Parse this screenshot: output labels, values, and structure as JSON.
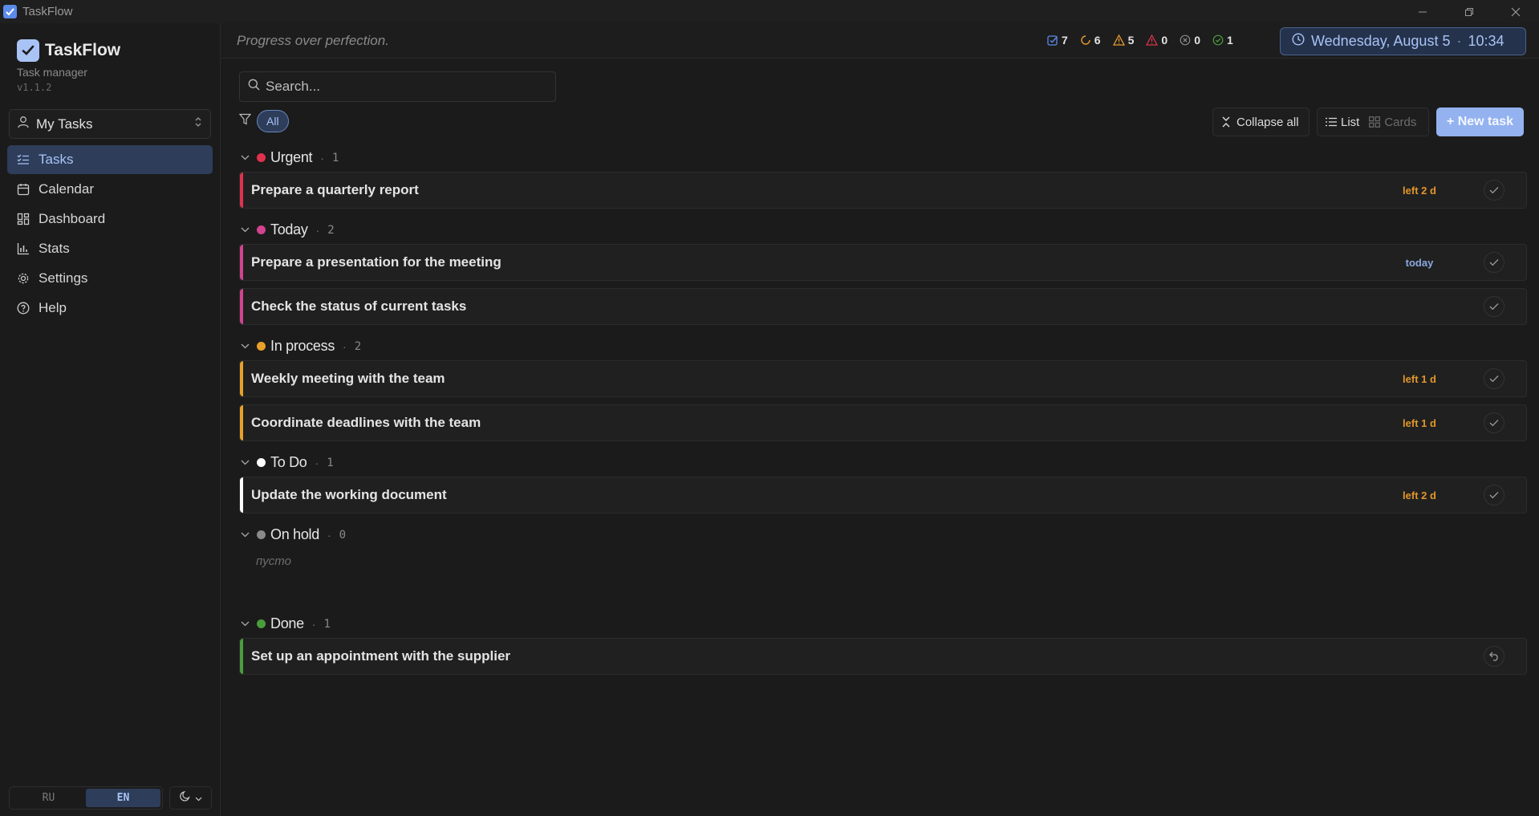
{
  "window": {
    "title": "TaskFlow"
  },
  "brand": {
    "name": "TaskFlow",
    "subtitle": "Task manager",
    "version": "v1.1.2"
  },
  "workspace": {
    "label": "My Tasks"
  },
  "nav": [
    {
      "label": "Tasks",
      "icon": "list-check-icon",
      "active": true
    },
    {
      "label": "Calendar",
      "icon": "calendar-icon",
      "active": false
    },
    {
      "label": "Dashboard",
      "icon": "dashboard-icon",
      "active": false
    },
    {
      "label": "Stats",
      "icon": "bar-chart-icon",
      "active": false
    },
    {
      "label": "Settings",
      "icon": "gear-icon",
      "active": false
    },
    {
      "label": "Help",
      "icon": "help-circle-icon",
      "active": false
    }
  ],
  "language": {
    "options": [
      "RU",
      "EN"
    ],
    "selected": "EN"
  },
  "header": {
    "motto": "Progress over perfection.",
    "stats": [
      {
        "icon": "checkbox-icon",
        "value": "7",
        "color": "#5b8be8"
      },
      {
        "icon": "loading-icon",
        "value": "6",
        "color": "#e89a2c"
      },
      {
        "icon": "warning-icon",
        "value": "5",
        "color": "#e89a2c"
      },
      {
        "icon": "alert-triangle-icon",
        "value": "0",
        "color": "#d9344c"
      },
      {
        "icon": "cancel-circle-icon",
        "value": "0",
        "color": "#8a8a8a"
      },
      {
        "icon": "check-circle-icon",
        "value": "1",
        "color": "#4a9e3a"
      }
    ],
    "date": "Wednesday, August 5",
    "time": "10:34"
  },
  "toolbar": {
    "search_placeholder": "Search...",
    "filter_chip": "All",
    "collapse_label": "Collapse all",
    "view_list": "List",
    "view_cards": "Cards",
    "new_task": "+ New task"
  },
  "groups": [
    {
      "name": "Urgent",
      "count": "1",
      "color": "#e0314e",
      "tasks": [
        {
          "title": "Prepare a quarterly report",
          "due": "left 2 d",
          "due_color": "#e2962a",
          "action": "check"
        }
      ]
    },
    {
      "name": "Today",
      "count": "2",
      "color": "#d2438f",
      "tasks": [
        {
          "title": "Prepare a presentation for the meeting",
          "due": "today",
          "due_color": "#8aa8e0",
          "action": "check"
        },
        {
          "title": "Check the status of current tasks",
          "due": "",
          "due_color": "#8a8a8a",
          "action": "check"
        }
      ]
    },
    {
      "name": "In process",
      "count": "2",
      "color": "#e8a02a",
      "tasks": [
        {
          "title": "Weekly meeting with the team",
          "due": "left 1 d",
          "due_color": "#e2962a",
          "action": "check"
        },
        {
          "title": "Coordinate deadlines with the team",
          "due": "left 1 d",
          "due_color": "#e2962a",
          "action": "check"
        }
      ]
    },
    {
      "name": "To Do",
      "count": "1",
      "color": "#ffffff",
      "tasks": [
        {
          "title": "Update the working document",
          "due": "left 2 d",
          "due_color": "#e2962a",
          "action": "check"
        }
      ]
    },
    {
      "name": "On hold",
      "count": "0",
      "color": "#8a8a8a",
      "tasks": [],
      "empty_text": "пусто"
    },
    {
      "name": "Done",
      "count": "1",
      "color": "#4a9e3a",
      "tasks": [
        {
          "title": "Set up an appointment with the supplier",
          "due": "",
          "due_color": "#8a8a8a",
          "action": "undo"
        }
      ]
    }
  ]
}
